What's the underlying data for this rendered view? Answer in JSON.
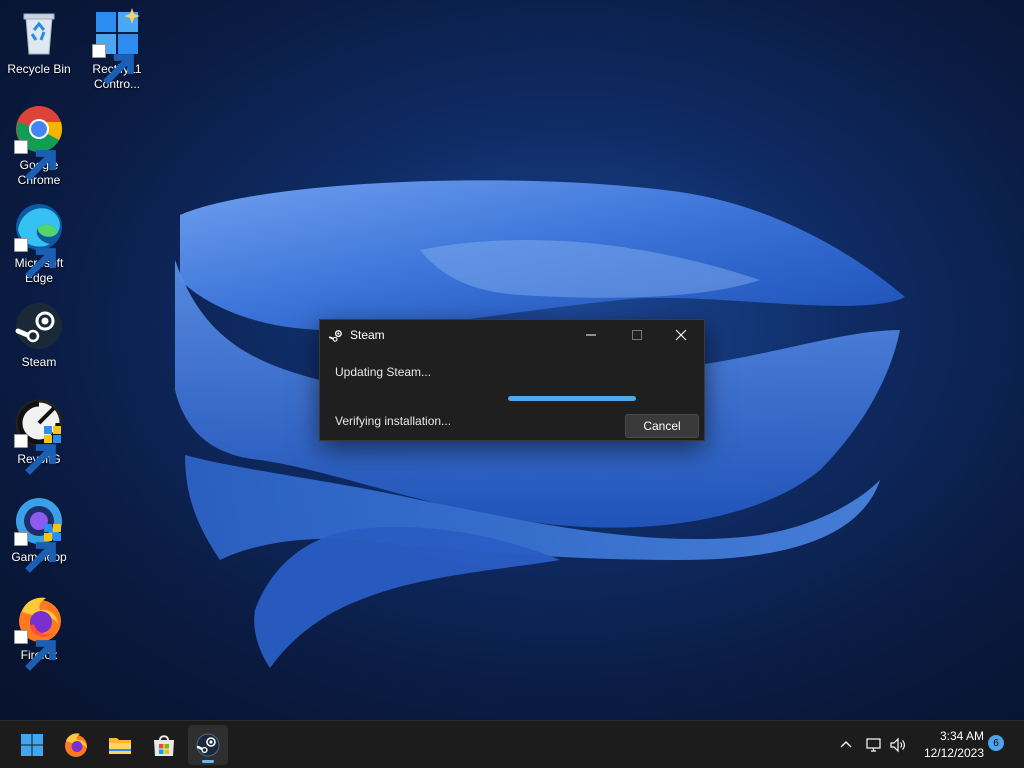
{
  "desktop": {
    "icons": [
      {
        "label": "Recycle Bin",
        "icon": "recycle-bin-icon"
      },
      {
        "label": "Rectify11 Contro...",
        "icon": "rectify11-control-panel-icon"
      },
      {
        "label": "Google Chrome",
        "icon": "chrome-icon"
      },
      {
        "label": "Microsoft Edge",
        "icon": "edge-icon"
      },
      {
        "label": "Steam",
        "icon": "steam-icon"
      },
      {
        "label": "RevoltG",
        "icon": "revoltg-icon"
      },
      {
        "label": "Gameloop",
        "icon": "gameloop-icon"
      },
      {
        "label": "Firefox",
        "icon": "firefox-icon"
      }
    ]
  },
  "dialog": {
    "title": "Steam",
    "status": "Updating Steam...",
    "detail": "Verifying installation...",
    "cancel_label": "Cancel",
    "progress": 1.0,
    "accent": "#4fa8e8"
  },
  "taskbar": {
    "apps": [
      "start-icon",
      "firefox-icon",
      "file-explorer-icon",
      "microsoft-store-icon",
      "steam-icon"
    ],
    "active_app": "steam-icon",
    "tray_icons": [
      "chevron-up-icon",
      "network-icon",
      "volume-icon"
    ],
    "time": "3:34 AM",
    "date": "12/12/2023",
    "notifications": "6"
  }
}
